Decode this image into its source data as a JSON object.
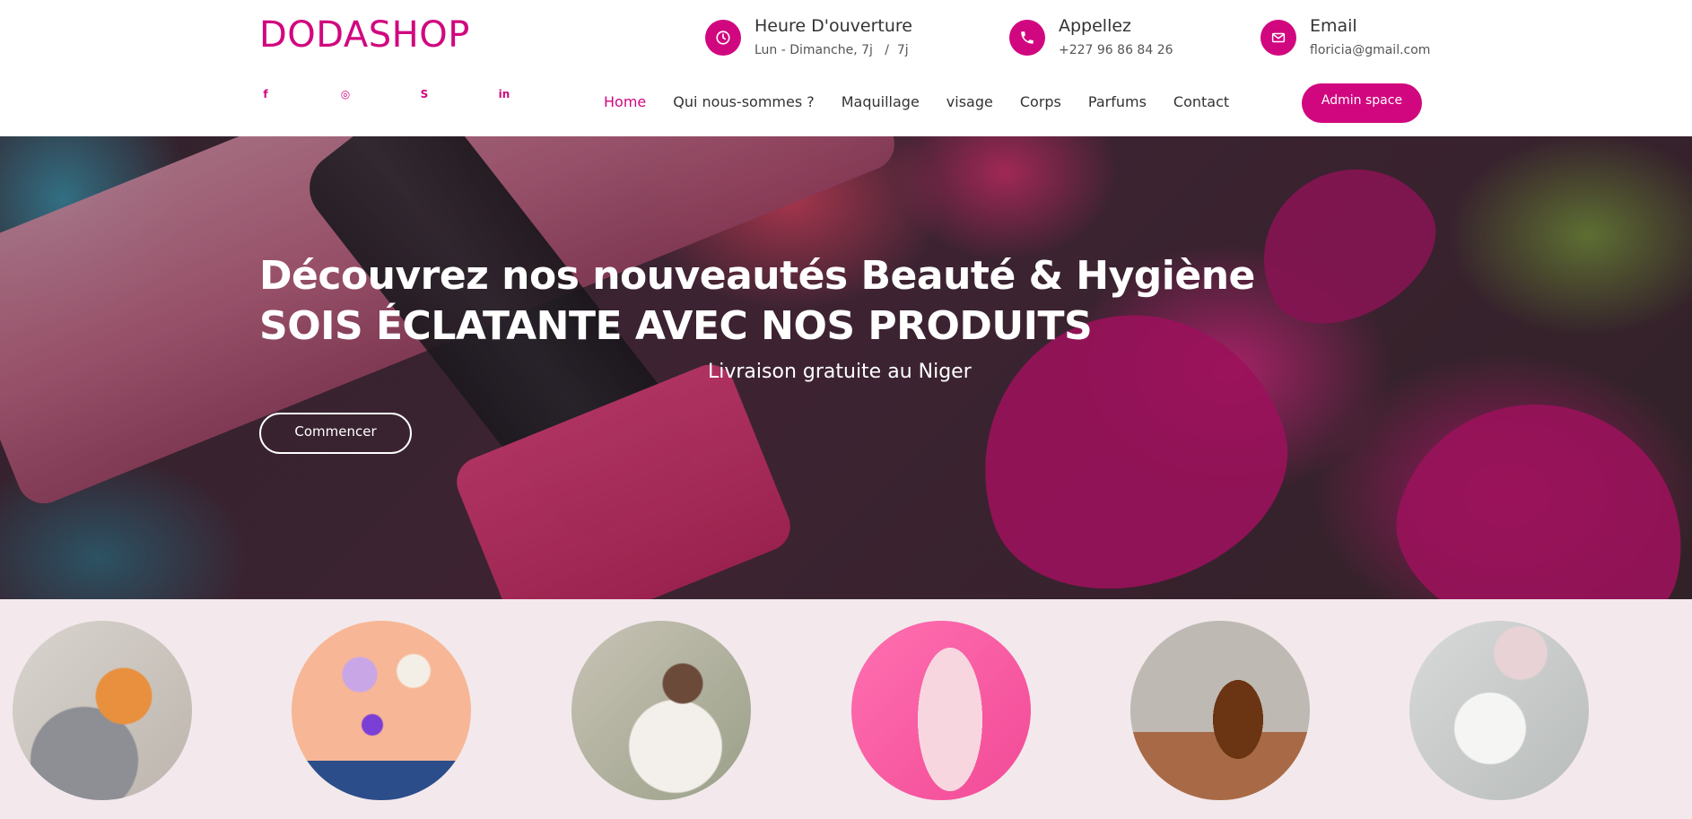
{
  "brand": {
    "name": "DODASHOP",
    "accent": "#d1077f"
  },
  "header": {
    "hours": {
      "title": "Heure D'ouverture",
      "detail": "Lun - Dimanche, 7j   /  7j",
      "icon": "clock-icon"
    },
    "phone": {
      "title": "Appellez",
      "detail": "+227 96 86 84 26",
      "icon": "phone-icon"
    },
    "email": {
      "title": "Email",
      "detail": "floricia@gmail.com",
      "icon": "envelope-icon"
    },
    "social": [
      {
        "name": "facebook-icon",
        "glyph": "f"
      },
      {
        "name": "instagram-icon",
        "glyph": "◎"
      },
      {
        "name": "skype-icon",
        "glyph": "S"
      },
      {
        "name": "linkedin-icon",
        "glyph": "in"
      }
    ],
    "nav": [
      "Home",
      "Qui nous-sommes ?",
      "Maquillage",
      "visage",
      "Corps",
      "Parfums",
      "Contact"
    ],
    "active_nav": "Home",
    "admin_button": "Admin space"
  },
  "hero": {
    "headline_1": "Découvrez nos nouveautés Beauté & Hygiène",
    "headline_2": "SOIS ÉCLATANTE AVEC NOS PRODUITS",
    "tagline": "Livraison gratuite au Niger",
    "cta": "Commencer"
  },
  "categories": [
    {
      "name": "parfums-category-image"
    },
    {
      "name": "maquillage-category-image"
    },
    {
      "name": "visage-category-image"
    },
    {
      "name": "soins-category-image"
    },
    {
      "name": "corps-category-image"
    },
    {
      "name": "creme-category-image"
    }
  ]
}
